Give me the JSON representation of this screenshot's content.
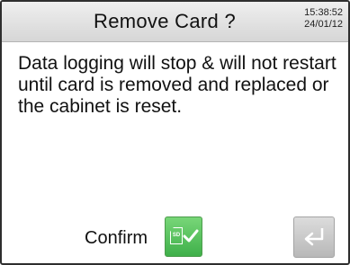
{
  "header": {
    "title": "Remove Card ?",
    "time": "15:38:52",
    "date": "24/01/12"
  },
  "message": "Data logging will stop & will not restart until card is removed and replaced or the cabinet is reset.",
  "confirm": {
    "label": "Confirm",
    "sd_label": "SD"
  },
  "icons": {
    "confirm_button": "sd-card-check-icon",
    "enter_button": "enter-return-arrow-icon"
  },
  "colors": {
    "confirm_green": "#4cbb52",
    "header_gray": "#dedede",
    "enter_gray": "#c8c8c8"
  }
}
